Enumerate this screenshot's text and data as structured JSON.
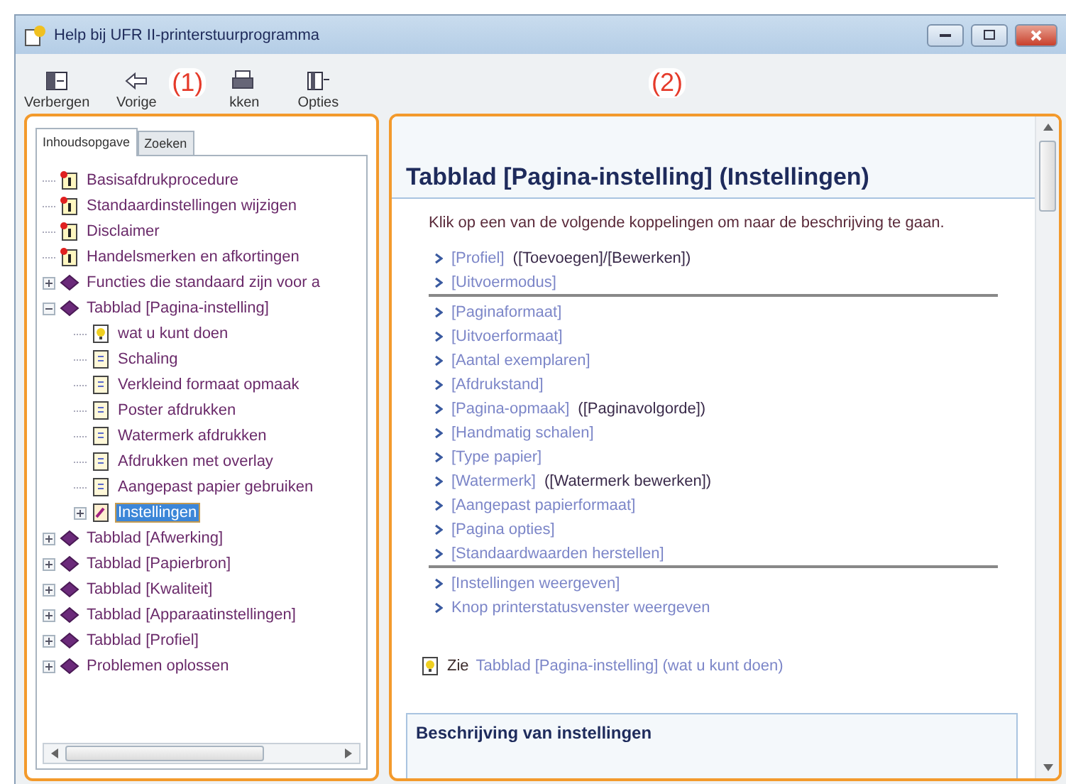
{
  "window": {
    "title": "Help bij UFR II-printerstuurprogramma"
  },
  "toolbar": [
    {
      "label": "Verbergen",
      "kind": "hide"
    },
    {
      "label": "Vorige",
      "kind": "back"
    },
    {
      "label": "kken",
      "kind": "print"
    },
    {
      "label": "Opties",
      "kind": "options"
    }
  ],
  "callouts": [
    {
      "label": "(1)"
    },
    {
      "label": "(2)"
    }
  ],
  "nav_tabs": [
    {
      "label": "Inhoudsopgave",
      "selected": true
    },
    {
      "label": "Zoeken",
      "selected": false
    }
  ],
  "tree": [
    {
      "label": "Basisafdrukprocedure",
      "kind": "topic",
      "selected": false
    },
    {
      "label": "Standaardinstellingen wijzigen",
      "kind": "topic",
      "selected": false
    },
    {
      "label": "Disclaimer",
      "kind": "topic",
      "selected": false
    },
    {
      "label": "Handelsmerken en afkortingen",
      "kind": "topic",
      "selected": false
    },
    {
      "label": "Functies die standaard zijn voor a",
      "kind": "book",
      "expanded": false,
      "selected": false
    },
    {
      "label": "Tabblad [Pagina-instelling]",
      "kind": "book",
      "expanded": true,
      "selected": false,
      "children": [
        {
          "label": "wat u kunt doen",
          "kind": "tip",
          "selected": false
        },
        {
          "label": "Schaling",
          "kind": "page",
          "selected": false
        },
        {
          "label": "Verkleind formaat opmaak",
          "kind": "page",
          "selected": false
        },
        {
          "label": "Poster afdrukken",
          "kind": "page",
          "selected": false
        },
        {
          "label": "Watermerk afdrukken",
          "kind": "page",
          "selected": false
        },
        {
          "label": "Afdrukken met overlay",
          "kind": "page",
          "selected": false
        },
        {
          "label": "Aangepast papier gebruiken",
          "kind": "page",
          "selected": false
        },
        {
          "label": "Instellingen",
          "kind": "settings",
          "expanded": false,
          "selected": true
        }
      ]
    },
    {
      "label": "Tabblad [Afwerking]",
      "kind": "book",
      "expanded": false,
      "selected": false
    },
    {
      "label": "Tabblad [Papierbron]",
      "kind": "book",
      "expanded": false,
      "selected": false
    },
    {
      "label": "Tabblad [Kwaliteit]",
      "kind": "book",
      "expanded": false,
      "selected": false
    },
    {
      "label": "Tabblad [Apparaatinstellingen]",
      "kind": "book",
      "expanded": false,
      "selected": false
    },
    {
      "label": "Tabblad [Profiel]",
      "kind": "book",
      "expanded": false,
      "selected": false
    },
    {
      "label": "Problemen oplossen",
      "kind": "book",
      "expanded": false,
      "selected": false
    }
  ],
  "content": {
    "heading": "Tabblad [Pagina-instelling] (Instellingen)",
    "intro": "Klik op een van de volgende koppelingen om naar de beschrijving te gaan.",
    "link_groups": [
      [
        {
          "link": "[Profiel]",
          "extra": "([Toevoegen]/[Bewerken])"
        },
        {
          "link": "[Uitvoermodus]"
        }
      ],
      [
        {
          "link": "[Paginaformaat]"
        },
        {
          "link": "[Uitvoerformaat]"
        },
        {
          "link": "[Aantal exemplaren]"
        },
        {
          "link": "[Afdrukstand]"
        },
        {
          "link": "[Pagina-opmaak]",
          "extra": "([Paginavolgorde])"
        },
        {
          "link": "[Handmatig schalen]"
        },
        {
          "link": "[Type papier]"
        },
        {
          "link": "[Watermerk]",
          "extra": "([Watermerk bewerken])"
        },
        {
          "link": "[Aangepast papierformaat]"
        },
        {
          "link": "[Pagina opties]"
        },
        {
          "link": "[Standaardwaarden herstellen]"
        }
      ],
      [
        {
          "link": "[Instellingen weergeven]"
        },
        {
          "link": "Knop printerstatusvenster weergeven"
        }
      ]
    ],
    "see_also": {
      "prefix": "Zie",
      "link": "Tabblad [Pagina-instelling] (wat u kunt doen)"
    },
    "section_heading": "Beschrijving van instellingen"
  }
}
